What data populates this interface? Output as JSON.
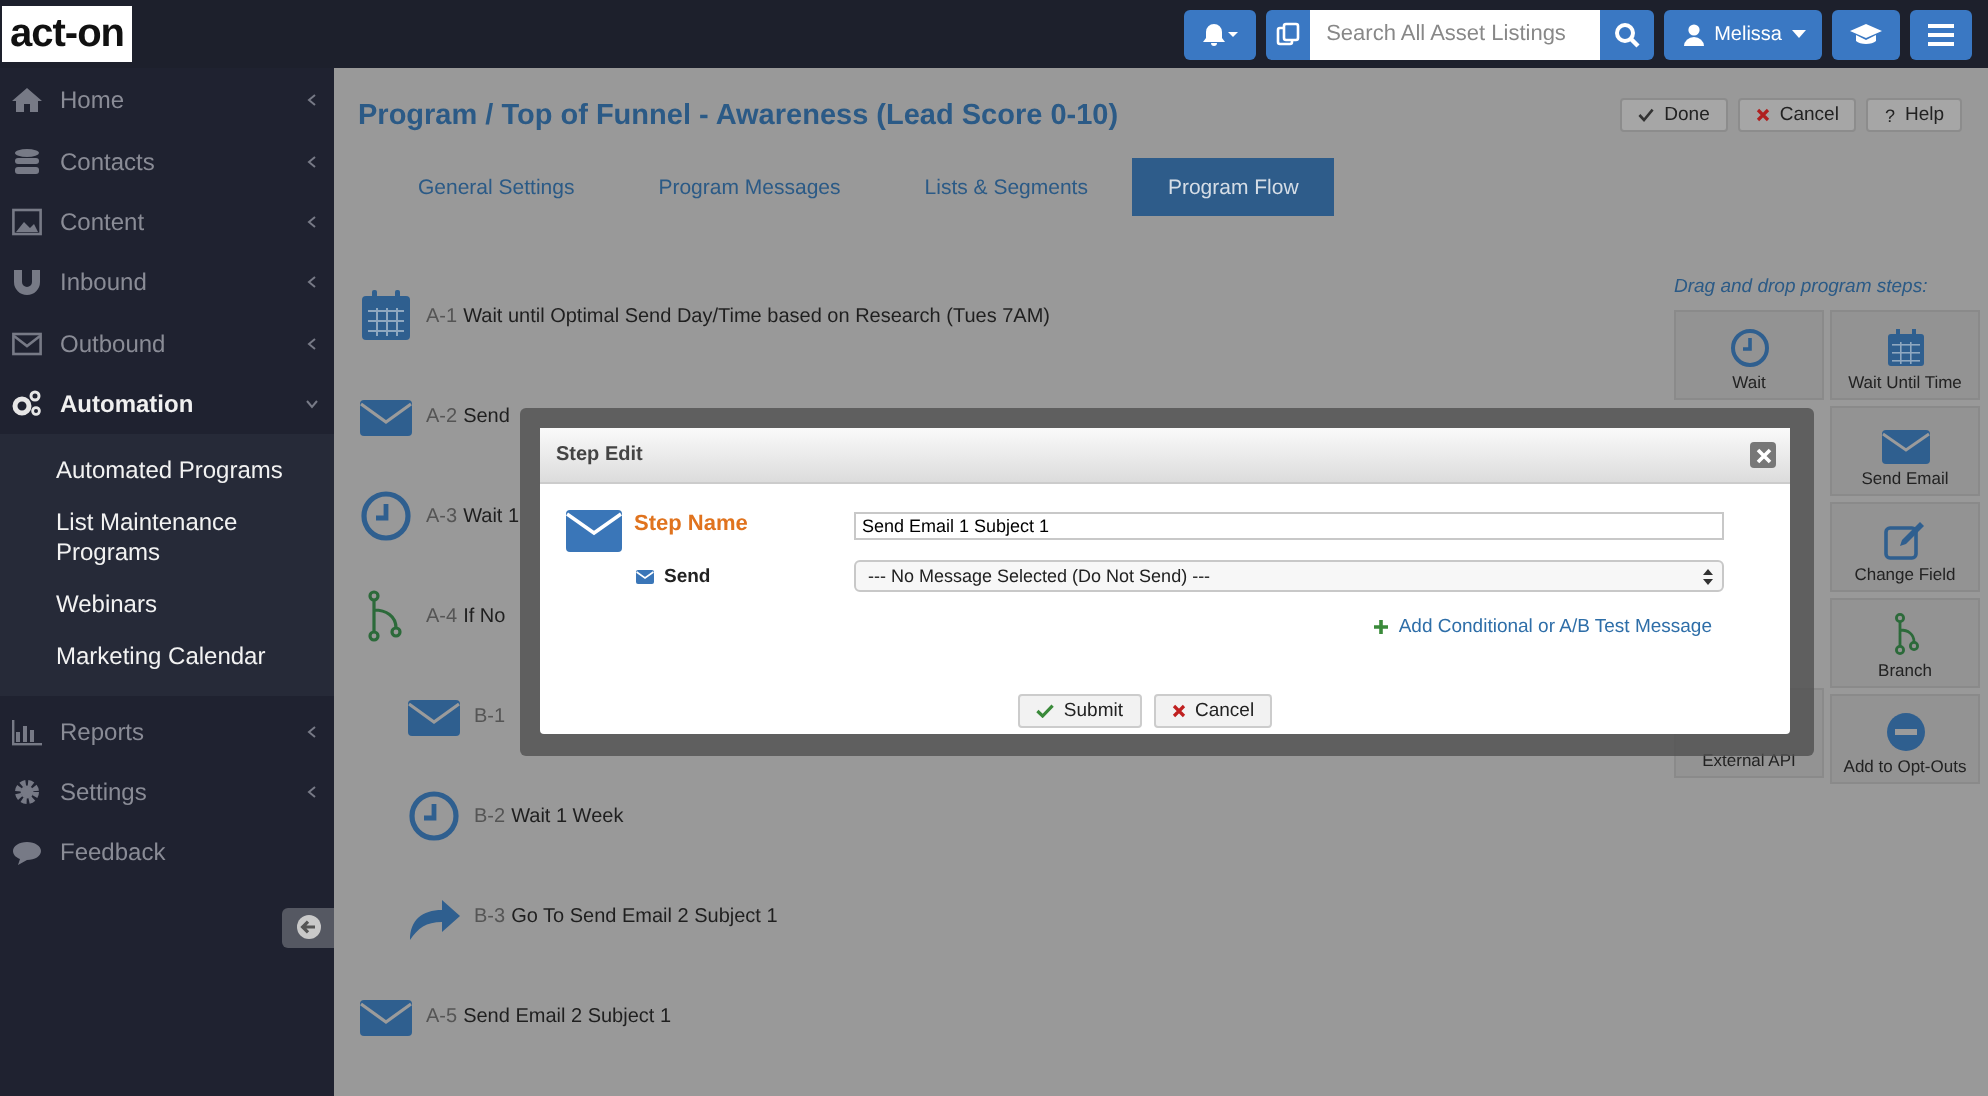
{
  "topbar": {
    "logo": "act-on",
    "search": {
      "placeholder": "Search All Asset Listings"
    },
    "user": "Melissa"
  },
  "sidebar": {
    "items": [
      {
        "label": "Home",
        "expandable": true,
        "expanded": false
      },
      {
        "label": "Contacts",
        "expandable": true,
        "expanded": false
      },
      {
        "label": "Content",
        "expandable": true,
        "expanded": false
      },
      {
        "label": "Inbound",
        "expandable": true,
        "expanded": false
      },
      {
        "label": "Outbound",
        "expandable": true,
        "expanded": false
      },
      {
        "label": "Automation",
        "expandable": true,
        "expanded": true,
        "children": [
          "Automated Programs",
          "List Maintenance Programs",
          "Webinars",
          "Marketing Calendar"
        ]
      },
      {
        "label": "Reports",
        "expandable": true,
        "expanded": false
      },
      {
        "label": "Settings",
        "expandable": true,
        "expanded": false
      },
      {
        "label": "Feedback",
        "expandable": false,
        "expanded": false
      }
    ]
  },
  "page": {
    "title": "Program  /  Top of Funnel - Awareness (Lead Score 0-10)",
    "actions": [
      {
        "label": "Done",
        "kind": "done"
      },
      {
        "label": "Cancel",
        "kind": "cancel"
      },
      {
        "label": "Help",
        "kind": "help",
        "glyph": "?"
      }
    ],
    "tabs": [
      {
        "label": "General Settings",
        "selected": false
      },
      {
        "label": "Program Messages",
        "selected": false
      },
      {
        "label": "Lists & Segments",
        "selected": false
      },
      {
        "label": "Program Flow",
        "selected": true
      }
    ],
    "steps": [
      {
        "code": "A-1",
        "text": "Wait until Optimal Send Day/Time based on Research (Tues 7AM)",
        "kind": "calendar"
      },
      {
        "code": "A-2",
        "text": "Send",
        "kind": "email"
      },
      {
        "code": "A-3",
        "text": "Wait 1",
        "kind": "clock"
      },
      {
        "code": "A-4",
        "text": "If No",
        "kind": "branch",
        "children": [
          {
            "code": "B-1",
            "kind": "email"
          },
          {
            "code": "B-2",
            "text": "Wait 1 Week",
            "kind": "clock"
          },
          {
            "code": "B-3",
            "text": "Go To Send Email 2 Subject 1",
            "kind": "goto"
          }
        ]
      },
      {
        "code": "A-5",
        "text": "Send Email 2 Subject 1",
        "kind": "email"
      }
    ],
    "palette": {
      "title": "Drag and drop program steps:",
      "left": [
        {
          "label": "Wait",
          "kind": "clock"
        },
        {
          "label": "External API",
          "kind": "api"
        }
      ],
      "right": [
        {
          "label": "Wait Until Time",
          "kind": "calendar"
        },
        {
          "label": "Send Email",
          "kind": "email"
        },
        {
          "label": "Change Field",
          "kind": "edit"
        },
        {
          "label": "Branch",
          "kind": "branch"
        },
        {
          "label": "Add to Opt-Outs",
          "kind": "minus"
        }
      ]
    }
  },
  "dialog": {
    "title": "Step Edit",
    "step_name_label": "Step Name",
    "step_name_value": "Send Email 1 Subject 1",
    "send_label": "Send",
    "send_value": "--- No Message Selected (Do Not Send) ---",
    "add_link": "Add Conditional or A/B Test Message",
    "buttons": [
      {
        "label": "Submit",
        "kind": "submit"
      },
      {
        "label": "Cancel",
        "kind": "cancel"
      }
    ]
  }
}
